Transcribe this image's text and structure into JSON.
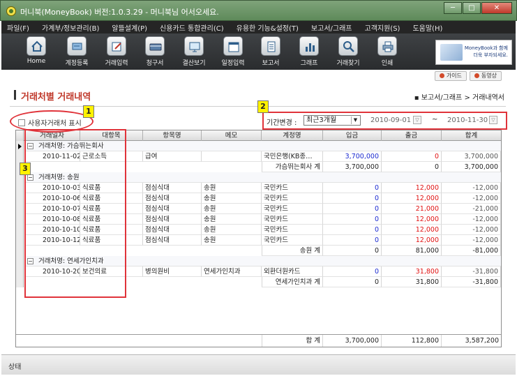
{
  "window": {
    "title": "머니북(MoneyBook) 버전:1.0.3.29 - 머니북님 어서오세요.",
    "controls": [
      "─",
      "□",
      "✕"
    ]
  },
  "menu": [
    "파일(F)",
    "가계부/정보관리(B)",
    "알뜰설계(P)",
    "신용카드 통합관리(C)",
    "유용한 기능&설정(T)",
    "보고서/그래프",
    "고객지원(S)",
    "도움말(H)"
  ],
  "toolbar": [
    {
      "label": "Home",
      "icon": "home-icon"
    },
    {
      "label": "계정등록",
      "icon": "account-register-icon"
    },
    {
      "label": "거래입력",
      "icon": "transaction-entry-icon"
    },
    {
      "label": "청구서",
      "icon": "card-bill-icon"
    },
    {
      "label": "결산보기",
      "icon": "monitor-icon"
    },
    {
      "label": "일정입력",
      "icon": "calendar-icon"
    },
    {
      "label": "보고서",
      "icon": "report-icon"
    },
    {
      "label": "그래프",
      "icon": "bar-chart-icon"
    },
    {
      "label": "거래찾기",
      "icon": "search-icon"
    },
    {
      "label": "인쇄",
      "icon": "printer-icon"
    }
  ],
  "ad": {
    "line1": "MoneyBook과 함께",
    "line2": "더욱 부자되세요."
  },
  "guide_buttons": [
    "가이드",
    "동영상"
  ],
  "page": {
    "title": "거래처별 거래내역",
    "breadcrumb": "▪ 보고서/그래프 > 거래내역서"
  },
  "filters": {
    "user_vendor_label": "사용자거래처 표시",
    "period_label": "기간변경 :",
    "period_value": "최근3개월",
    "date_from": "2010-09-01",
    "date_to": "2010-11-30",
    "tilde": "~"
  },
  "annotations": [
    "1",
    "2",
    "3"
  ],
  "table": {
    "columns": [
      "거래일자",
      "대항목",
      "항목명",
      "메모",
      "계정명",
      "입금",
      "출금",
      "합계"
    ],
    "groups": [
      {
        "header": "거래처명: 가슴뛰는회사",
        "rows": [
          {
            "date": "2010-11-02",
            "major": "근로소득",
            "item": "급여",
            "memo": "",
            "account": "국민은행(KB종…",
            "in": "3,700,000",
            "out": "0",
            "total": "3,700,000"
          }
        ],
        "subtotal": {
          "label": "가슴뛰는회사 계",
          "in": "3,700,000",
          "out": "0",
          "total": "3,700,000"
        }
      },
      {
        "header": "거래처명: 송원",
        "rows": [
          {
            "date": "2010-10-03",
            "major": "식료품",
            "item": "점심식대",
            "memo": "송원",
            "account": "국민카드",
            "in": "0",
            "out": "12,000",
            "total": "-12,000"
          },
          {
            "date": "2010-10-06",
            "major": "식료품",
            "item": "점심식대",
            "memo": "송원",
            "account": "국민카드",
            "in": "0",
            "out": "12,000",
            "total": "-12,000"
          },
          {
            "date": "2010-10-07",
            "major": "식료품",
            "item": "점심식대",
            "memo": "송원",
            "account": "국민카드",
            "in": "0",
            "out": "21,000",
            "total": "-21,000"
          },
          {
            "date": "2010-10-08",
            "major": "식료품",
            "item": "점심식대",
            "memo": "송원",
            "account": "국민카드",
            "in": "0",
            "out": "12,000",
            "total": "-12,000"
          },
          {
            "date": "2010-10-10",
            "major": "식료품",
            "item": "점심식대",
            "memo": "송원",
            "account": "국민카드",
            "in": "0",
            "out": "12,000",
            "total": "-12,000"
          },
          {
            "date": "2010-10-12",
            "major": "식료품",
            "item": "점심식대",
            "memo": "송원",
            "account": "국민카드",
            "in": "0",
            "out": "12,000",
            "total": "-12,000"
          }
        ],
        "subtotal": {
          "label": "송원 계",
          "in": "0",
          "out": "81,000",
          "total": "-81,000"
        }
      },
      {
        "header": "거래처명: 연세가인치과",
        "rows": [
          {
            "date": "2010-10-20",
            "major": "보건의료",
            "item": "병의원비",
            "memo": "연세가인치과",
            "account": "외환더원카드",
            "in": "0",
            "out": "31,800",
            "total": "-31,800"
          }
        ],
        "subtotal": {
          "label": "연세가인치과 계",
          "in": "0",
          "out": "31,800",
          "total": "-31,800"
        }
      }
    ],
    "grand_total": {
      "label": "합 계",
      "in": "3,700,000",
      "out": "112,800",
      "total": "3,587,200"
    }
  },
  "status": "상태",
  "colors": {
    "title_red": "#c0392b",
    "annotation_red": "#e0333a",
    "income_blue": "#1b2ad0",
    "expense_red": "#e01010",
    "badge_yellow": "#fff200"
  }
}
